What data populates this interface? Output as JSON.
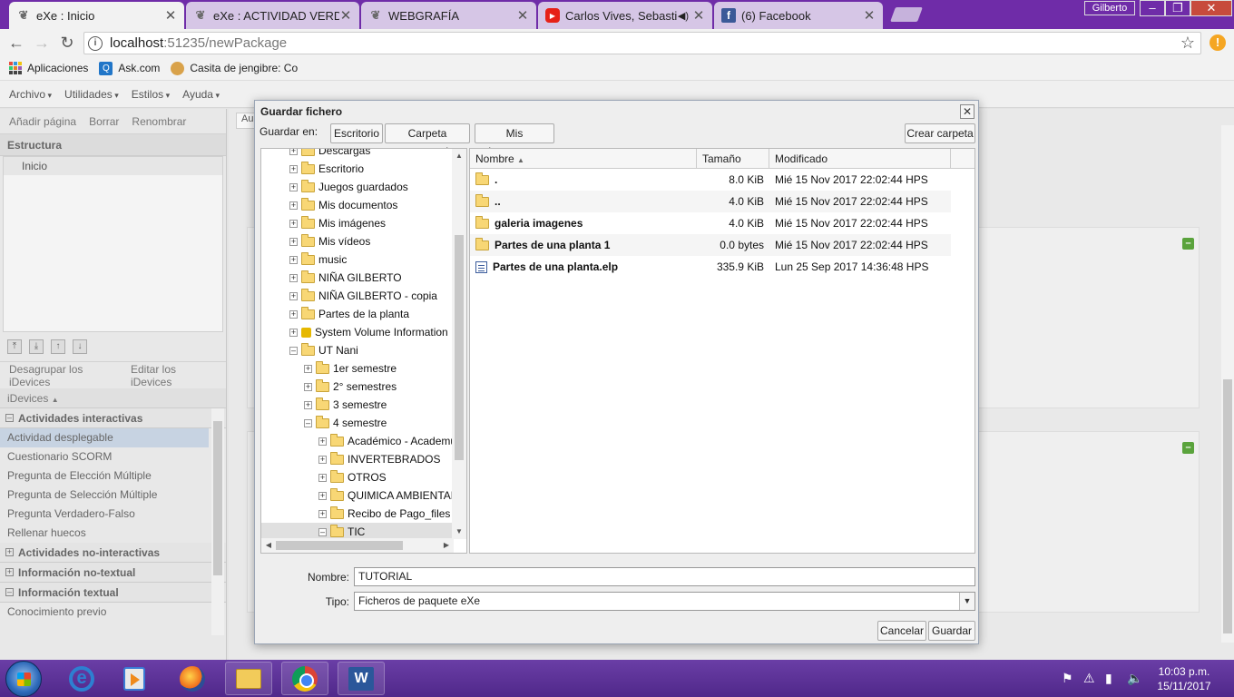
{
  "browser": {
    "tabs": [
      {
        "title": "eXe : Inicio",
        "icon": "exe-icon",
        "active": true
      },
      {
        "title": "eXe : ACTIVIDAD VERDADERA",
        "icon": "exe-icon",
        "active": false
      },
      {
        "title": "WEBGRAFÍA",
        "icon": "exe-icon",
        "active": false
      },
      {
        "title": "Carlos Vives, Sebastián Yatra",
        "icon": "youtube-icon",
        "active": false
      },
      {
        "title": "(6) Facebook",
        "icon": "facebook-icon",
        "active": false
      }
    ],
    "profile_name": "Gilberto",
    "url_host": "localhost",
    "url_rest": ":51235/newPackage",
    "bookmarks": [
      {
        "label": "Aplicaciones",
        "icon": "apps-grid-icon"
      },
      {
        "label": "Ask.com",
        "icon": "ask-icon"
      },
      {
        "label": "Casita de jengibre: Co",
        "icon": "gingerbread-icon"
      }
    ]
  },
  "exe": {
    "menu": [
      "Archivo",
      "Utilidades",
      "Estilos",
      "Ayuda"
    ],
    "outline_toolbar": [
      "Añadir página",
      "Borrar",
      "Renombrar"
    ],
    "structure_title": "Estructura",
    "structure_nodes": [
      "Inicio"
    ],
    "idevice_toolbar": [
      "Desagrupar los iDevices",
      "Editar los iDevices"
    ],
    "idevices_header": "iDevices",
    "idevice_categories": [
      {
        "name": "Actividades interactivas",
        "expanded": true,
        "items": [
          "Actividad desplegable",
          "Cuestionario SCORM",
          "Pregunta de Elección Múltiple",
          "Pregunta de Selección Múltiple",
          "Pregunta Verdadero-Falso",
          "Rellenar huecos"
        ]
      },
      {
        "name": "Actividades no-interactivas",
        "expanded": false,
        "items": []
      },
      {
        "name": "Información no-textual",
        "expanded": false,
        "items": []
      },
      {
        "name": "Información textual",
        "expanded": true,
        "items": [
          "Conocimiento previo"
        ]
      }
    ],
    "selected_idevice": "Actividad desplegable",
    "content_tab": "Au"
  },
  "dialog": {
    "title": "Guardar fichero",
    "save_in_label": "Guardar en:",
    "places": [
      "Escritorio",
      "Carpeta personal",
      "Mis documentos"
    ],
    "create_folder": "Crear carpeta",
    "tree": [
      {
        "label": "Descargas",
        "level": 0,
        "sign": "+"
      },
      {
        "label": "Escritorio",
        "level": 0,
        "sign": "+"
      },
      {
        "label": "Juegos guardados",
        "level": 0,
        "sign": "+"
      },
      {
        "label": "Mis documentos",
        "level": 0,
        "sign": "+"
      },
      {
        "label": "Mis imágenes",
        "level": 0,
        "sign": "+"
      },
      {
        "label": "Mis vídeos",
        "level": 0,
        "sign": "+"
      },
      {
        "label": "music",
        "level": 0,
        "sign": "+"
      },
      {
        "label": "NIÑA GILBERTO",
        "level": 0,
        "sign": "+"
      },
      {
        "label": "NIÑA GILBERTO - copia",
        "level": 0,
        "sign": "+"
      },
      {
        "label": "Partes de la planta",
        "level": 0,
        "sign": "+"
      },
      {
        "label": "System Volume Information",
        "level": 0,
        "sign": "+",
        "locked": true
      },
      {
        "label": "UT Nani",
        "level": 0,
        "sign": "-"
      },
      {
        "label": "1er semestre",
        "level": 1,
        "sign": "+"
      },
      {
        "label": "2° semestres",
        "level": 1,
        "sign": "+"
      },
      {
        "label": "3 semestre",
        "level": 1,
        "sign": "+"
      },
      {
        "label": "4 semestre",
        "level": 1,
        "sign": "-"
      },
      {
        "label": "Académico - Academusoft",
        "level": 2,
        "sign": "+"
      },
      {
        "label": "INVERTEBRADOS",
        "level": 2,
        "sign": "+"
      },
      {
        "label": "OTROS",
        "level": 2,
        "sign": "+"
      },
      {
        "label": "QUIMICA AMBIENTAL",
        "level": 2,
        "sign": "+"
      },
      {
        "label": "Recibo de Pago_files",
        "level": 2,
        "sign": "+"
      },
      {
        "label": "TIC",
        "level": 2,
        "sign": "-",
        "selected": true
      }
    ],
    "columns": {
      "name": "Nombre",
      "size": "Tamaño",
      "modified": "Modificado"
    },
    "files": [
      {
        "name": ".",
        "size": "8.0 KiB",
        "modified": "Mié 15 Nov 2017 22:02:44 HPS",
        "kind": "folder"
      },
      {
        "name": "..",
        "size": "4.0 KiB",
        "modified": "Mié 15 Nov 2017 22:02:44 HPS",
        "kind": "folder"
      },
      {
        "name": "galeria imagenes",
        "size": "4.0 KiB",
        "modified": "Mié 15 Nov 2017 22:02:44 HPS",
        "kind": "folder"
      },
      {
        "name": "Partes de una planta 1",
        "size": "0.0 bytes",
        "modified": "Mié 15 Nov 2017 22:02:44 HPS",
        "kind": "folder"
      },
      {
        "name": "Partes de una planta.elp",
        "size": "335.9 KiB",
        "modified": "Lun 25 Sep 2017 14:36:48 HPS",
        "kind": "file"
      }
    ],
    "name_label": "Nombre:",
    "name_value": "TUTORIAL",
    "type_label": "Tipo:",
    "type_value": "Ficheros de paquete eXe",
    "cancel": "Cancelar",
    "save": "Guardar"
  },
  "taskbar": {
    "time": "10:03 p.m.",
    "date": "15/11/2017"
  }
}
